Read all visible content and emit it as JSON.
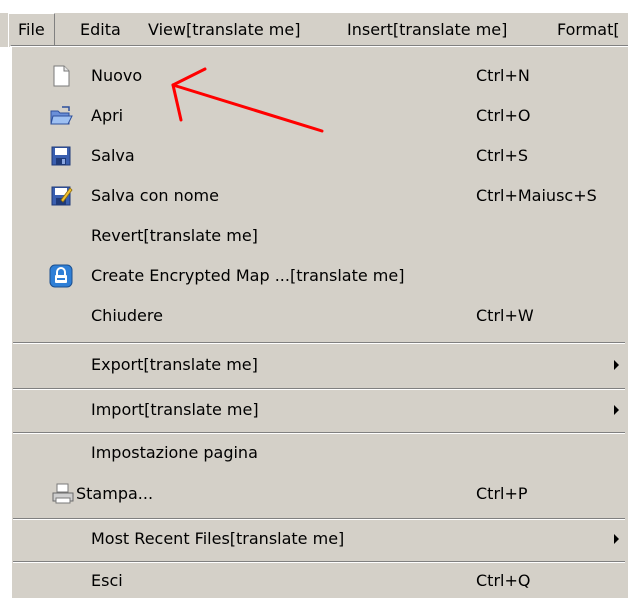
{
  "menubar": {
    "items": [
      {
        "label": "File"
      },
      {
        "label": "Edita"
      },
      {
        "label": "View[translate me]"
      },
      {
        "label": "Insert[translate me]"
      },
      {
        "label": "Format["
      }
    ]
  },
  "file_menu": {
    "items": [
      {
        "label": "Nuovo",
        "shortcut": "Ctrl+N",
        "icon": "new-document-icon"
      },
      {
        "label": "Apri",
        "shortcut": "Ctrl+O",
        "icon": "open-folder-icon"
      },
      {
        "label": "Salva",
        "shortcut": "Ctrl+S",
        "icon": "save-disk-icon"
      },
      {
        "label": "Salva con nome",
        "shortcut": "Ctrl+Maiusc+S",
        "icon": "save-as-icon"
      },
      {
        "label": "Revert[translate me]",
        "shortcut": ""
      },
      {
        "label": "Create Encrypted Map ...[translate me]",
        "shortcut": "",
        "icon": "lock-icon"
      },
      {
        "label": "Chiudere",
        "shortcut": "Ctrl+W"
      },
      {
        "label": "Export[translate me]",
        "submenu": true
      },
      {
        "label": "Import[translate me]",
        "submenu": true
      },
      {
        "label": "Impostazione pagina",
        "shortcut": ""
      },
      {
        "label": "Stampa...",
        "shortcut": "Ctrl+P",
        "icon": "printer-icon"
      },
      {
        "label": "Most Recent Files[translate me]",
        "submenu": true
      },
      {
        "label": "Esci",
        "shortcut": "Ctrl+Q"
      }
    ]
  },
  "colors": {
    "menu_bg": "#d4d0c8",
    "annotation": "#ff0000"
  }
}
